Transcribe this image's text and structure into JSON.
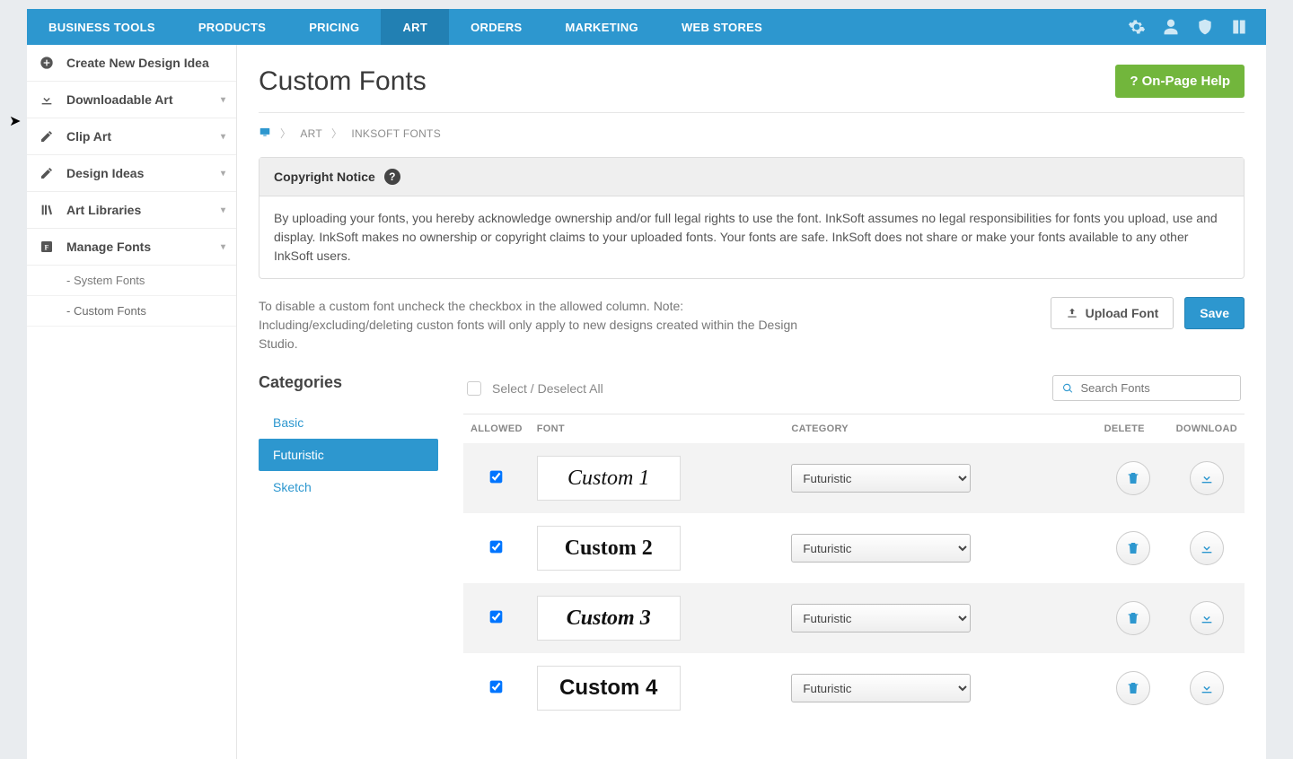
{
  "topbar": {
    "items": [
      {
        "label": "BUSINESS TOOLS",
        "active": false
      },
      {
        "label": "PRODUCTS",
        "active": false
      },
      {
        "label": "PRICING",
        "active": false
      },
      {
        "label": "ART",
        "active": true
      },
      {
        "label": "ORDERS",
        "active": false
      },
      {
        "label": "MARKETING",
        "active": false
      },
      {
        "label": "WEB STORES",
        "active": false
      }
    ]
  },
  "sidebar": {
    "items": [
      {
        "label": "Create New Design Idea",
        "expandable": false
      },
      {
        "label": "Downloadable Art",
        "expandable": true
      },
      {
        "label": "Clip Art",
        "expandable": true
      },
      {
        "label": "Design Ideas",
        "expandable": true
      },
      {
        "label": "Art Libraries",
        "expandable": true
      },
      {
        "label": "Manage Fonts",
        "expandable": true
      }
    ],
    "sub_items": [
      {
        "label": "- System Fonts",
        "active": false
      },
      {
        "label": "- Custom Fonts",
        "active": true
      }
    ]
  },
  "heading": {
    "title": "Custom Fonts",
    "help": "?  On-Page Help"
  },
  "breadcrumb": {
    "home": "⌂",
    "a": "ART",
    "b": "INKSOFT FONTS"
  },
  "notice": {
    "title": "Copyright Notice",
    "body": "By uploading your fonts, you hereby acknowledge ownership and/or full legal rights to use the font. InkSoft assumes no legal responsibilities for fonts you upload, use and display. InkSoft makes no ownership or copyright claims to your uploaded fonts.  Your fonts are safe. InkSoft does not share or make your fonts available to any other InkSoft users."
  },
  "actions": {
    "note": "To disable a custom font uncheck the checkbox in the allowed column. Note: Including/excluding/deleting custon fonts will only apply to new designs created within the Design Studio.",
    "upload": "Upload Font",
    "save": "Save"
  },
  "categories": {
    "title": "Categories",
    "items": [
      {
        "label": "Basic",
        "active": false
      },
      {
        "label": "Futuristic",
        "active": true
      },
      {
        "label": "Sketch",
        "active": false
      }
    ]
  },
  "table": {
    "select_all": "Select / Deselect All",
    "search_placeholder": "Search Fonts",
    "headers": {
      "allowed": "ALLOWED",
      "font": "FONT",
      "category": "CATEGORY",
      "delete": "DELETE",
      "download": "DOWNLOAD"
    },
    "rows": [
      {
        "allowed": true,
        "preview": "Custom 1",
        "category": "Futuristic"
      },
      {
        "allowed": true,
        "preview": "Custom 2",
        "category": "Futuristic"
      },
      {
        "allowed": true,
        "preview": "Custom 3",
        "category": "Futuristic"
      },
      {
        "allowed": true,
        "preview": "Custom 4",
        "category": "Futuristic"
      }
    ]
  }
}
